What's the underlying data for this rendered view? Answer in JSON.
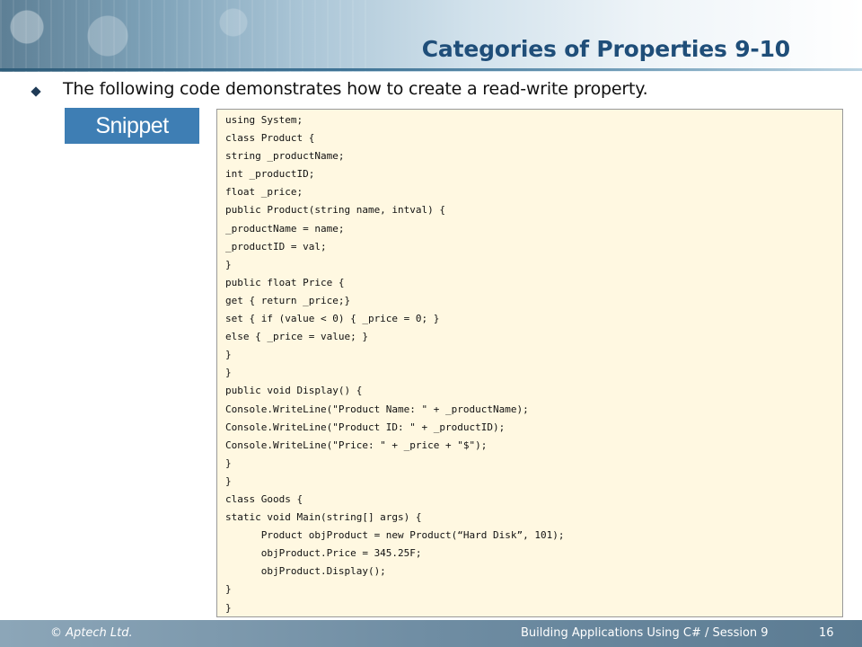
{
  "slide": {
    "title": "Categories of Properties 9-10",
    "bullet": "The following code demonstrates how to create a read-write property.",
    "snippet_label": "Snippet"
  },
  "code": {
    "lines": [
      "using System;",
      "class Product {",
      "string _productName;",
      "int _productID;",
      "float _price;",
      "public Product(string name, intval) {",
      "_productName = name;",
      "_productID = val;",
      "}",
      "public float Price {",
      "get { return _price;}",
      "set { if (value < 0) { _price = 0; }",
      "else { _price = value; }",
      "}",
      "}",
      "public void Display() {",
      "Console.WriteLine(\"Product Name: \" + _productName);",
      "Console.WriteLine(\"Product ID: \" + _productID);",
      "Console.WriteLine(\"Price: \" + _price + \"$\");",
      "}",
      "}",
      "class Goods {",
      "static void Main(string[] args) {",
      "      Product objProduct = new Product(“Hard Disk”, 101);",
      "      objProduct.Price = 345.25F;",
      "      objProduct.Display();",
      "}",
      "}"
    ]
  },
  "footer": {
    "copyright": "© Aptech Ltd.",
    "course": "Building Applications Using C# / Session 9",
    "page_number": "16"
  },
  "colors": {
    "title": "#1f4e79",
    "snippet_bg": "#3e7eb4",
    "code_bg": "#fff8e1"
  }
}
